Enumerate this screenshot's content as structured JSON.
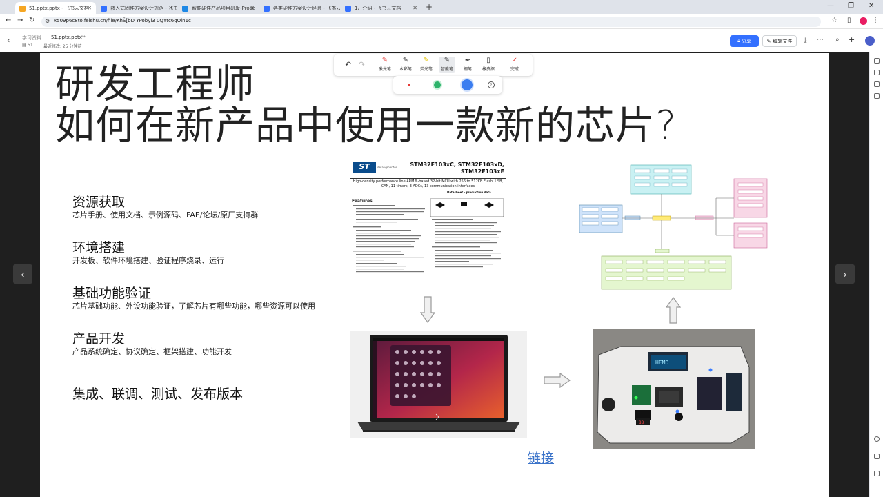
{
  "browser": {
    "tabs": [
      {
        "title": "51.pptx.pptx - 飞书云文档",
        "active": true
      },
      {
        "title": "嵌入式固件方案设计规范 - 飞书",
        "active": false
      },
      {
        "title": "智能硬件产品项目研发-Proce",
        "active": false
      },
      {
        "title": "各类硬件方案设计经验 - 飞书云",
        "active": false
      },
      {
        "title": "1、介绍 - 飞书云文档",
        "active": false
      }
    ],
    "url": "x509p6c8to.feishu.cn/file/KhŠ[bD YPobyl3 0QYtc6qOin1c"
  },
  "doc_header": {
    "breadcrumb": "学习资料",
    "file_name": "51.pptx.pptx",
    "views": "51",
    "modified": "最近修改: 25 分钟前",
    "share_label": "分享",
    "edit_label": "编辑文件"
  },
  "toolbar": {
    "tools": [
      {
        "label": "激光笔",
        "icon": "laser-pen-icon"
      },
      {
        "label": "水彩笔",
        "icon": "watercolor-pen-icon"
      },
      {
        "label": "荧光笔",
        "icon": "highlighter-icon"
      },
      {
        "label": "智能笔",
        "icon": "smart-pen-icon",
        "selected": true
      },
      {
        "label": "钢笔",
        "icon": "fountain-pen-icon"
      },
      {
        "label": "橡皮擦",
        "icon": "eraser-icon"
      },
      {
        "label": "完成",
        "icon": "check-icon"
      }
    ],
    "colors": [
      "#e53935",
      "#2db36b",
      "#3a7df0"
    ]
  },
  "slide": {
    "title_line1": "研发工程师",
    "title_line2": "如何在新产品中使用一款新的芯片?",
    "sections": [
      {
        "heading": "资源获取",
        "sub": "芯片手册、使用文档、示例源码、FAE/论坛/原厂支持群"
      },
      {
        "heading": "环境搭建",
        "sub": "开发板、软件环境搭建、验证程序烧录、运行"
      },
      {
        "heading": "基础功能验证",
        "sub": "芯片基础功能、外设功能验证，了解芯片有哪些功能，哪些资源可以使用"
      },
      {
        "heading": "产品开发",
        "sub": "产品系统确定、协议确定、框架搭建、功能开发"
      }
    ],
    "final": "集成、联调、测试、发布版本",
    "link": "链接",
    "datasheet": {
      "brand": "life.augmented",
      "part_title": "STM32F103xC, STM32F103xD,\nSTM32F103xE",
      "subtitle": "High-density performance line ARM®-based 32-bit MCU with 256 to 512KB Flash, USB, CAN, 11 timers, 3 ADCs, 13 communication interfaces",
      "note": "Datasheet - production data",
      "features_heading": "Features"
    }
  }
}
